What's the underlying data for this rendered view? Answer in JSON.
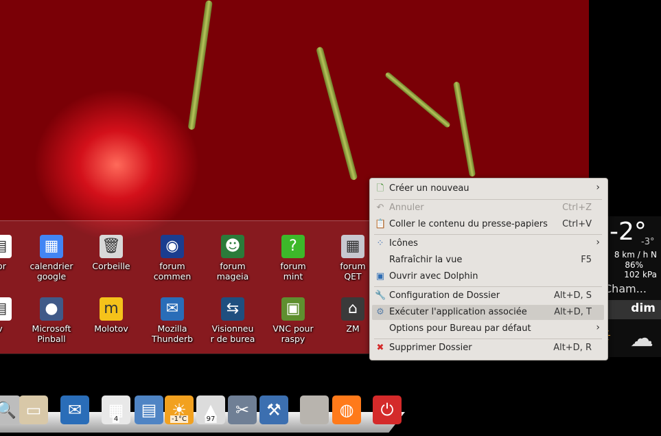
{
  "desktop_icons_row1": [
    {
      "label": "tor",
      "icon": "text-icon"
    },
    {
      "label": "calendrier\ngoogle",
      "icon": "google-calendar-icon"
    },
    {
      "label": "Corbeille",
      "icon": "trash-icon"
    },
    {
      "label": "forum\ncommen",
      "icon": "forum-commentcamarche-icon"
    },
    {
      "label": "forum\nmageia",
      "icon": "forum-mageia-icon"
    },
    {
      "label": "forum\nmint",
      "icon": "forum-mint-icon"
    },
    {
      "label": "forum\nQET",
      "icon": "forum-qet-icon"
    }
  ],
  "desktop_icons_row2": [
    {
      "label": "v",
      "icon": "text-icon"
    },
    {
      "label": "Microsoft\nPinball",
      "icon": "pinball-icon"
    },
    {
      "label": "Molotov",
      "icon": "molotov-icon"
    },
    {
      "label": "Mozilla\nThunderb",
      "icon": "thunderbird-icon"
    },
    {
      "label": "Visionneu\nr de burea",
      "icon": "remote-desktop-viewer-icon"
    },
    {
      "label": "VNC pour\nraspy",
      "icon": "vnc-icon"
    },
    {
      "label": "ZM",
      "icon": "zm-icon"
    }
  ],
  "weather": {
    "temp": "-2°",
    "temp_min": "-3°",
    "wind": "8 km / h N",
    "humidity": "86%",
    "pressure": "102 kPa",
    "city": "Cham...",
    "day": "dim"
  },
  "context_menu": {
    "items": [
      {
        "label": "Créer un nouveau",
        "shortcut": "",
        "submenu": true,
        "icon": "new-document-icon"
      },
      {
        "label": "Annuler",
        "shortcut": "Ctrl+Z",
        "disabled": true,
        "icon": "undo-icon"
      },
      {
        "label": "Coller le contenu du presse-papiers",
        "shortcut": "Ctrl+V",
        "icon": "paste-icon"
      },
      {
        "label": "Icônes",
        "shortcut": "",
        "submenu": true,
        "icon": "icons-view-icon"
      },
      {
        "label": "Rafraîchir la vue",
        "shortcut": "F5",
        "icon": ""
      },
      {
        "label": "Ouvrir avec Dolphin",
        "shortcut": "",
        "icon": "dolphin-icon"
      },
      {
        "label": "Configuration de Dossier",
        "shortcut": "Alt+D, S",
        "icon": "wrench-icon"
      },
      {
        "label": "Exécuter l'application associée",
        "shortcut": "Alt+D, T",
        "highlighted": true,
        "icon": "gear-icon"
      },
      {
        "label": "Options pour Bureau par défaut",
        "shortcut": "",
        "submenu": true,
        "icon": ""
      },
      {
        "label": "Supprimer Dossier",
        "shortcut": "Alt+D, R",
        "icon": "delete-icon"
      }
    ]
  },
  "dock": {
    "items": [
      {
        "name": "magnifier-icon"
      },
      {
        "name": "file-cabinet-icon"
      },
      {
        "name": "thunderbird-icon"
      },
      {
        "name": "virtual-desktops-icon",
        "badge": "4"
      },
      {
        "name": "file-manager-icon"
      },
      {
        "name": "weather-sun-icon",
        "badge": "-1°C"
      },
      {
        "name": "updates-icon",
        "badge": "97"
      },
      {
        "name": "tools-icon"
      },
      {
        "name": "system-settings-icon"
      },
      {
        "name": "blank-app-icon"
      },
      {
        "name": "firefox-icon"
      },
      {
        "name": "power-icon"
      }
    ]
  },
  "colors": {
    "menu_bg": "#e6e3df",
    "menu_highlight": "#cfccc7",
    "delete_red": "#d42a2a"
  }
}
